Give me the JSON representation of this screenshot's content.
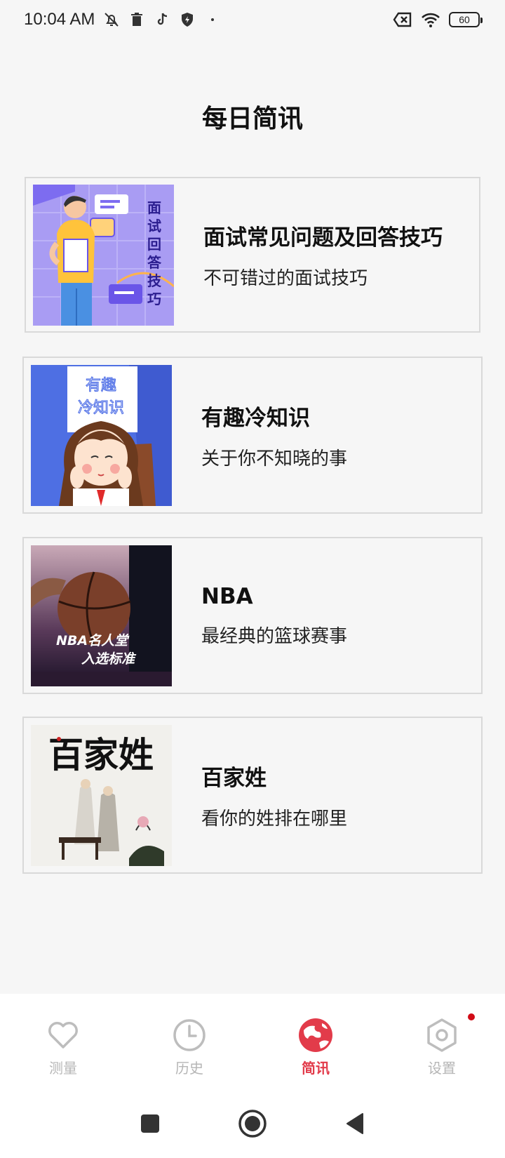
{
  "status": {
    "time": "10:04 AM",
    "battery": "60"
  },
  "page": {
    "title": "每日简讯"
  },
  "cards": [
    {
      "title": "面试常见问题及回答技巧",
      "subtitle": "不可错过的面试技巧",
      "image_text": [
        "面",
        "试",
        "回",
        "答",
        "技",
        "巧"
      ]
    },
    {
      "title": "有趣冷知识",
      "subtitle": "关于你不知晓的事",
      "image_text": [
        "有趣",
        "冷知识"
      ]
    },
    {
      "title": "NBA",
      "subtitle": "最经典的篮球赛事",
      "image_text": [
        "NBA名人堂",
        "入选标准"
      ]
    },
    {
      "title": "百家姓",
      "subtitle": "看你的姓排在哪里",
      "image_text": "百家姓"
    }
  ],
  "nav": [
    {
      "label": "测量",
      "icon": "heart-icon",
      "active": false
    },
    {
      "label": "历史",
      "icon": "clock-icon",
      "active": false
    },
    {
      "label": "简讯",
      "icon": "globe-icon",
      "active": true
    },
    {
      "label": "设置",
      "icon": "settings-hex-icon",
      "active": false
    }
  ],
  "colors": {
    "accent": "#e23b4a",
    "background": "#f6f6f6",
    "inactive": "#b6b6b6"
  }
}
